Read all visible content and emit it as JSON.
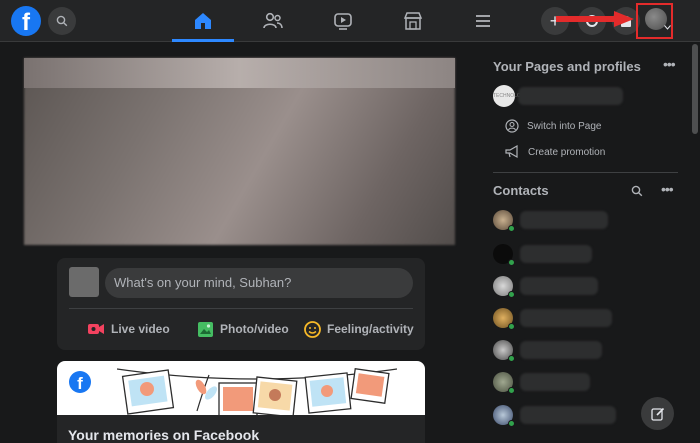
{
  "topbar": {
    "logo_text": "f",
    "nav": [
      {
        "name": "home-icon",
        "active": true
      },
      {
        "name": "friends-icon",
        "active": false
      },
      {
        "name": "watch-icon",
        "active": false
      },
      {
        "name": "marketplace-icon",
        "active": false
      },
      {
        "name": "menu-icon",
        "active": false
      }
    ],
    "create_label": "+",
    "accent_color": "#2d88ff",
    "highlight_color": "#e32b2b"
  },
  "composer": {
    "placeholder": "What's on your mind, Subhan?",
    "actions": [
      {
        "label": "Live video",
        "icon": "live-video-icon",
        "color": "#f3425f"
      },
      {
        "label": "Photo/video",
        "icon": "photo-icon",
        "color": "#45bd62"
      },
      {
        "label": "Feeling/activity",
        "icon": "feeling-icon",
        "color": "#f7b928"
      }
    ]
  },
  "memories": {
    "logo_text": "f",
    "title": "Your memories on Facebook"
  },
  "right_panel": {
    "pages_heading": "Your Pages and profiles",
    "page_avatar_text": "TECHNOLOGY",
    "switch_label": "Switch into Page",
    "promotion_label": "Create promotion",
    "contacts_heading": "Contacts"
  }
}
